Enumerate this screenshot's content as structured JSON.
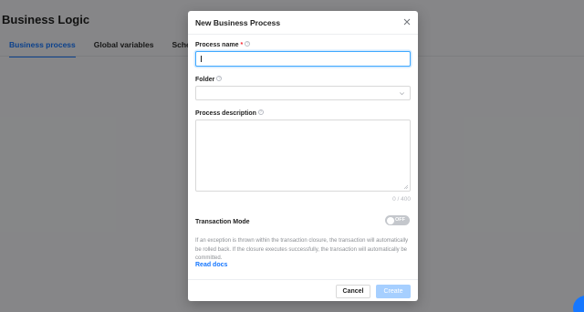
{
  "page": {
    "title": "Business Logic",
    "tabs": [
      {
        "label": "Business process",
        "active": true
      },
      {
        "label": "Global variables",
        "active": false
      },
      {
        "label": "Schedu",
        "active": false
      }
    ]
  },
  "modal": {
    "title": "New Business Process",
    "close_icon": "close-icon",
    "fields": {
      "process_name": {
        "label": "Process name",
        "required_mark": "*",
        "value": ""
      },
      "folder": {
        "label": "Folder",
        "value": ""
      },
      "description": {
        "label": "Process description",
        "value": "",
        "counter": "0 / 400"
      }
    },
    "transaction": {
      "label": "Transaction Mode",
      "toggle_text": "OFF",
      "enabled": false,
      "help": "If an exception is thrown within the transaction closure, the transaction will automatically be rolled back. If the closure executes successfully, the transaction will automatically be committed.",
      "link": "Read docs"
    },
    "footer": {
      "cancel_label": "Cancel",
      "create_label": "Create"
    }
  },
  "colors": {
    "accent": "#1677ff",
    "required": "#f5222d",
    "disabled_primary": "#a6cfff"
  }
}
